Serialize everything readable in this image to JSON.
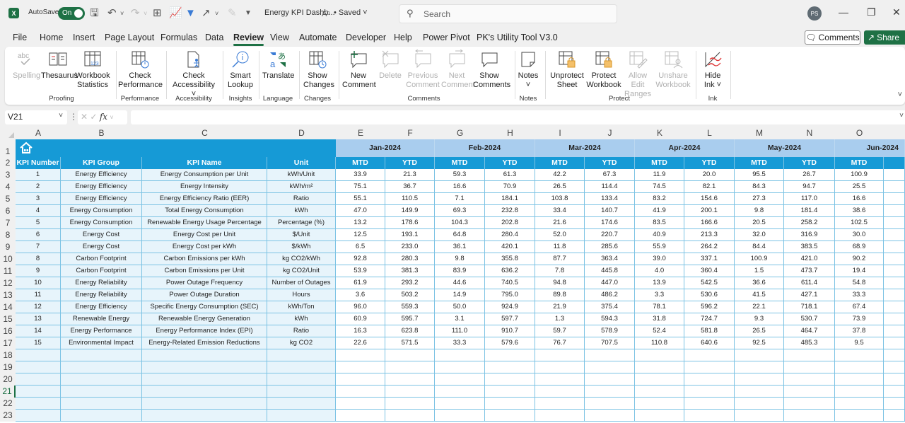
{
  "titlebar": {
    "autosave_label": "AutoSave",
    "autosave_state": "On",
    "document_title": "Energy KPI Dashb...",
    "save_status": "• Saved",
    "search_placeholder": "Search",
    "user_initials": "PS"
  },
  "menu": {
    "tabs": [
      "File",
      "Home",
      "Insert",
      "Page Layout",
      "Formulas",
      "Data",
      "Review",
      "View",
      "Automate",
      "Developer",
      "Help",
      "Power Pivot",
      "PK's Utility Tool V3.0"
    ],
    "active_tab": "Review",
    "comments_label": "Comments",
    "share_label": "Share"
  },
  "ribbon": {
    "groups": [
      {
        "label": "Proofing",
        "buttons": [
          {
            "label": "Spelling",
            "icon": "spelling-icon",
            "enabled": false
          },
          {
            "label": "Thesaurus",
            "icon": "thesaurus-icon",
            "enabled": true
          },
          {
            "label": "Workbook Statistics",
            "icon": "workbook-statistics-icon",
            "enabled": true
          }
        ]
      },
      {
        "label": "Performance",
        "buttons": [
          {
            "label": "Check Performance",
            "icon": "check-performance-icon",
            "enabled": true
          }
        ]
      },
      {
        "label": "Accessibility",
        "buttons": [
          {
            "label": "Check Accessibility",
            "icon": "check-accessibility-icon",
            "enabled": true,
            "dropdown": true
          }
        ]
      },
      {
        "label": "Insights",
        "buttons": [
          {
            "label": "Smart Lookup",
            "icon": "smart-lookup-icon",
            "enabled": true
          }
        ]
      },
      {
        "label": "Language",
        "buttons": [
          {
            "label": "Translate",
            "icon": "translate-icon",
            "enabled": true
          }
        ]
      },
      {
        "label": "Changes",
        "buttons": [
          {
            "label": "Show Changes",
            "icon": "show-changes-icon",
            "enabled": true
          }
        ]
      },
      {
        "label": "Comments",
        "buttons": [
          {
            "label": "New Comment",
            "icon": "new-comment-icon",
            "enabled": true
          },
          {
            "label": "Delete",
            "icon": "delete-comment-icon",
            "enabled": false
          },
          {
            "label": "Previous Comment",
            "icon": "previous-comment-icon",
            "enabled": false
          },
          {
            "label": "Next Comment",
            "icon": "next-comment-icon",
            "enabled": false
          },
          {
            "label": "Show Comments",
            "icon": "show-comments-icon",
            "enabled": true
          }
        ]
      },
      {
        "label": "Notes",
        "buttons": [
          {
            "label": "Notes",
            "icon": "notes-icon",
            "enabled": true,
            "dropdown": true
          }
        ]
      },
      {
        "label": "Protect",
        "buttons": [
          {
            "label": "Unprotect Sheet",
            "icon": "unprotect-sheet-icon",
            "enabled": true
          },
          {
            "label": "Protect Workbook",
            "icon": "protect-workbook-icon",
            "enabled": true
          },
          {
            "label": "Allow Edit Ranges",
            "icon": "allow-edit-ranges-icon",
            "enabled": false
          },
          {
            "label": "Unshare Workbook",
            "icon": "unshare-workbook-icon",
            "enabled": false
          }
        ]
      },
      {
        "label": "Ink",
        "buttons": [
          {
            "label": "Hide Ink",
            "icon": "hide-ink-icon",
            "enabled": true,
            "dropdown": true
          }
        ]
      }
    ]
  },
  "formula_bar": {
    "name_box": "V21",
    "fx_label": "fx",
    "formula": ""
  },
  "sheet": {
    "column_letters": [
      "A",
      "B",
      "C",
      "D",
      "E",
      "F",
      "G",
      "H",
      "I",
      "J",
      "K",
      "L",
      "M",
      "N",
      "O"
    ],
    "row_numbers": [
      1,
      2,
      3,
      4,
      5,
      6,
      7,
      8,
      9,
      10,
      11,
      12,
      13,
      14,
      15,
      16,
      17,
      18,
      19,
      20,
      21,
      22,
      23
    ],
    "selected_row": 21,
    "header_row": [
      "KPI Number",
      "KPI Group",
      "KPI Name",
      "Unit"
    ],
    "months": [
      "Jan-2024",
      "Feb-2024",
      "Mar-2024",
      "Apr-2024",
      "May-2024",
      "Jun-2024"
    ],
    "mtd_label": "MTD",
    "ytd_label": "YTD",
    "rows": [
      {
        "num": "1",
        "group": "Energy Efficiency",
        "name": "Energy Consumption per Unit",
        "unit": "kWh/Unit",
        "values": [
          "33.9",
          "21.3",
          "59.3",
          "61.3",
          "42.2",
          "67.3",
          "11.9",
          "20.0",
          "95.5",
          "26.7",
          "100.9"
        ]
      },
      {
        "num": "2",
        "group": "Energy Efficiency",
        "name": "Energy Intensity",
        "unit": "kWh/m²",
        "values": [
          "75.1",
          "36.7",
          "16.6",
          "70.9",
          "26.5",
          "114.4",
          "74.5",
          "82.1",
          "84.3",
          "94.7",
          "25.5"
        ]
      },
      {
        "num": "3",
        "group": "Energy Efficiency",
        "name": "Energy Efficiency Ratio (EER)",
        "unit": "Ratio",
        "values": [
          "55.1",
          "110.5",
          "7.1",
          "184.1",
          "103.8",
          "133.4",
          "83.2",
          "154.6",
          "27.3",
          "117.0",
          "16.6"
        ]
      },
      {
        "num": "4",
        "group": "Energy Consumption",
        "name": "Total Energy Consumption",
        "unit": "kWh",
        "values": [
          "47.0",
          "149.9",
          "69.3",
          "232.8",
          "33.4",
          "140.7",
          "41.9",
          "200.1",
          "9.8",
          "181.4",
          "38.6"
        ]
      },
      {
        "num": "5",
        "group": "Energy Consumption",
        "name": "Renewable Energy Usage Percentage",
        "unit": "Percentage (%)",
        "values": [
          "13.2",
          "178.6",
          "104.3",
          "202.8",
          "21.6",
          "174.6",
          "83.5",
          "166.6",
          "20.5",
          "258.2",
          "102.5"
        ]
      },
      {
        "num": "6",
        "group": "Energy Cost",
        "name": "Energy Cost per Unit",
        "unit": "$/Unit",
        "values": [
          "12.5",
          "193.1",
          "64.8",
          "280.4",
          "52.0",
          "220.7",
          "40.9",
          "213.3",
          "32.0",
          "316.9",
          "30.0"
        ]
      },
      {
        "num": "7",
        "group": "Energy Cost",
        "name": "Energy Cost per kWh",
        "unit": "$/kWh",
        "values": [
          "6.5",
          "233.0",
          "36.1",
          "420.1",
          "11.8",
          "285.6",
          "55.9",
          "264.2",
          "84.4",
          "383.5",
          "68.9"
        ]
      },
      {
        "num": "8",
        "group": "Carbon Footprint",
        "name": "Carbon Emissions per kWh",
        "unit": "kg CO2/kWh",
        "values": [
          "92.8",
          "280.3",
          "9.8",
          "355.8",
          "87.7",
          "363.4",
          "39.0",
          "337.1",
          "100.9",
          "421.0",
          "90.2"
        ]
      },
      {
        "num": "9",
        "group": "Carbon Footprint",
        "name": "Carbon Emissions per Unit",
        "unit": "kg CO2/Unit",
        "values": [
          "53.9",
          "381.3",
          "83.9",
          "636.2",
          "7.8",
          "445.8",
          "4.0",
          "360.4",
          "1.5",
          "473.7",
          "19.4"
        ]
      },
      {
        "num": "10",
        "group": "Energy Reliability",
        "name": "Power Outage Frequency",
        "unit": "Number of Outages",
        "values": [
          "61.9",
          "293.2",
          "44.6",
          "740.5",
          "94.8",
          "447.0",
          "13.9",
          "542.5",
          "36.6",
          "611.4",
          "54.8"
        ]
      },
      {
        "num": "11",
        "group": "Energy Reliability",
        "name": "Power Outage Duration",
        "unit": "Hours",
        "values": [
          "3.6",
          "503.2",
          "14.9",
          "795.0",
          "89.8",
          "486.2",
          "3.3",
          "530.6",
          "41.5",
          "427.1",
          "33.3"
        ]
      },
      {
        "num": "12",
        "group": "Energy Efficiency",
        "name": "Specific Energy Consumption (SEC)",
        "unit": "kWh/Ton",
        "values": [
          "96.0",
          "559.3",
          "50.0",
          "924.9",
          "21.9",
          "375.4",
          "78.1",
          "596.2",
          "22.1",
          "718.1",
          "67.4"
        ]
      },
      {
        "num": "13",
        "group": "Renewable Energy",
        "name": "Renewable Energy Generation",
        "unit": "kWh",
        "values": [
          "60.9",
          "595.7",
          "3.1",
          "597.7",
          "1.3",
          "594.3",
          "31.8",
          "724.7",
          "9.3",
          "530.7",
          "73.9"
        ]
      },
      {
        "num": "14",
        "group": "Energy Performance",
        "name": "Energy Performance Index (EPI)",
        "unit": "Ratio",
        "values": [
          "16.3",
          "623.8",
          "111.0",
          "910.7",
          "59.7",
          "578.9",
          "52.4",
          "581.8",
          "26.5",
          "464.7",
          "37.8"
        ]
      },
      {
        "num": "15",
        "group": "Environmental Impact",
        "name": "Energy-Related Emission Reductions",
        "unit": "kg CO2",
        "values": [
          "22.6",
          "571.5",
          "33.3",
          "579.6",
          "76.7",
          "707.5",
          "110.8",
          "640.6",
          "92.5",
          "485.3",
          "9.5"
        ]
      }
    ]
  },
  "colors": {
    "excel_green": "#1e7145",
    "header_blue": "#169ad6",
    "month_band": "#a9cdee",
    "left_block_fill": "#e7f4fb",
    "grid_line": "#7cc3e4"
  }
}
